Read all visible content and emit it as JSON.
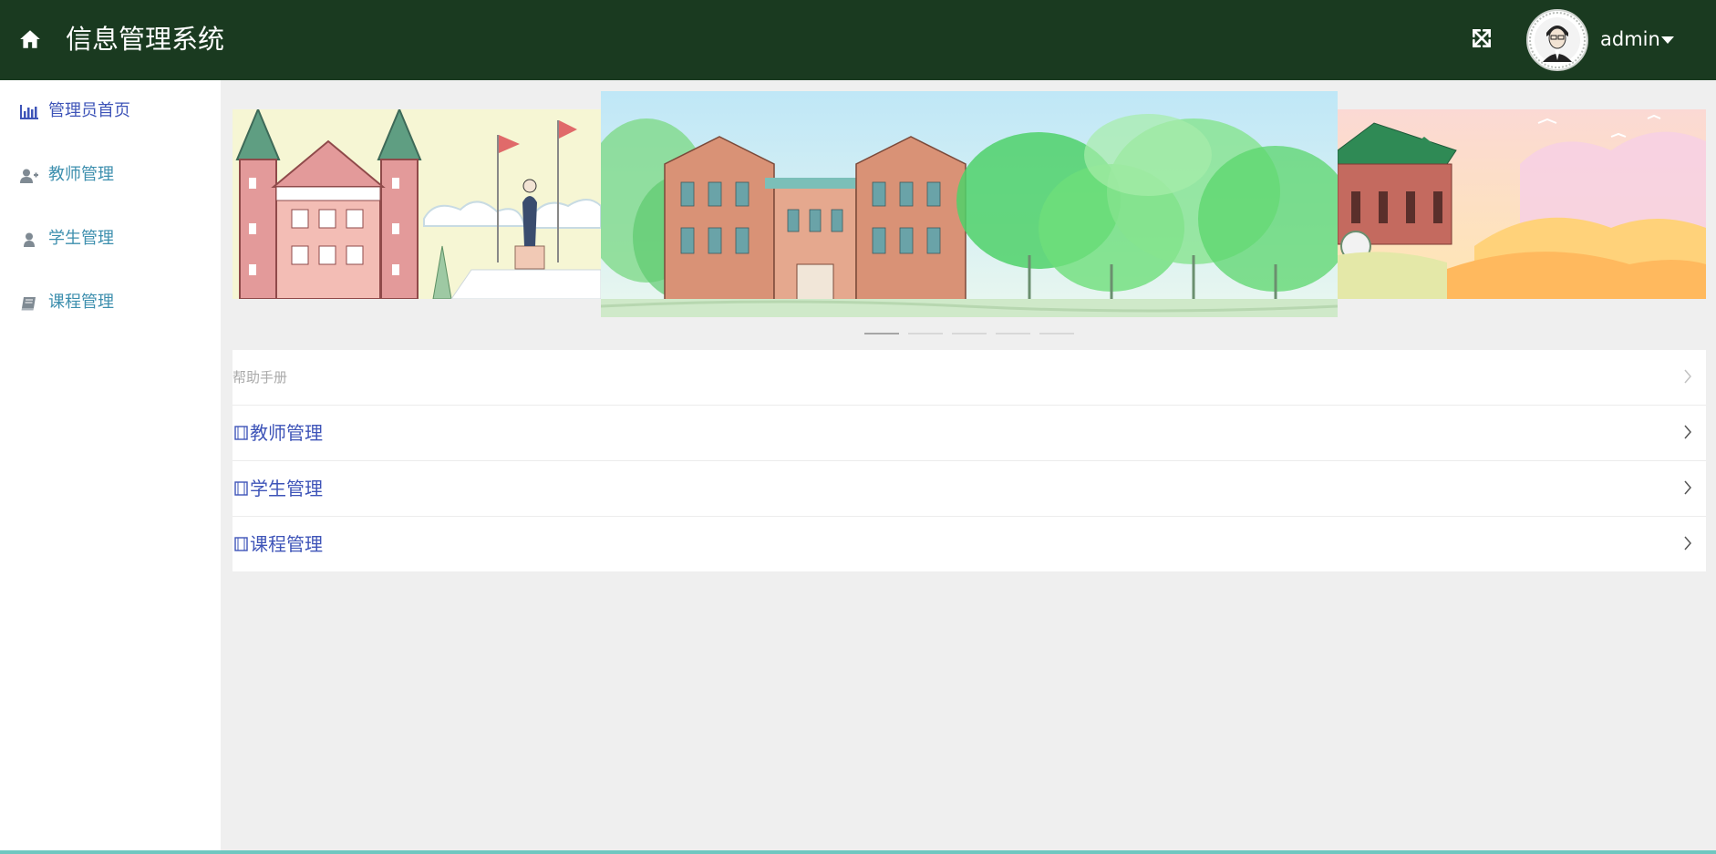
{
  "header": {
    "title": "信息管理系统",
    "username": "admin",
    "bg_color": "#1a3a20",
    "icons": {
      "home": "home-icon",
      "fullscreen": "fullscreen-icon",
      "dropdown": "caret-down-icon"
    }
  },
  "sidebar": {
    "items": [
      {
        "label": "管理员首页",
        "icon": "bar-chart-icon",
        "active": true
      },
      {
        "label": "教师管理",
        "icon": "user-plus-icon",
        "active": false
      },
      {
        "label": "学生管理",
        "icon": "user-icon",
        "active": false
      },
      {
        "label": "课程管理",
        "icon": "book-icon",
        "active": false
      }
    ]
  },
  "carousel": {
    "slide_count": 5,
    "active_index": 0
  },
  "help": {
    "title": "帮助手册",
    "items": [
      {
        "label": "教师管理"
      },
      {
        "label": "学生管理"
      },
      {
        "label": "课程管理"
      }
    ]
  },
  "colors": {
    "accent": "#3e54b8",
    "sidebar_text": "#3d8fae",
    "bottom_bar": "#6fc7c0",
    "background": "#efefef"
  }
}
